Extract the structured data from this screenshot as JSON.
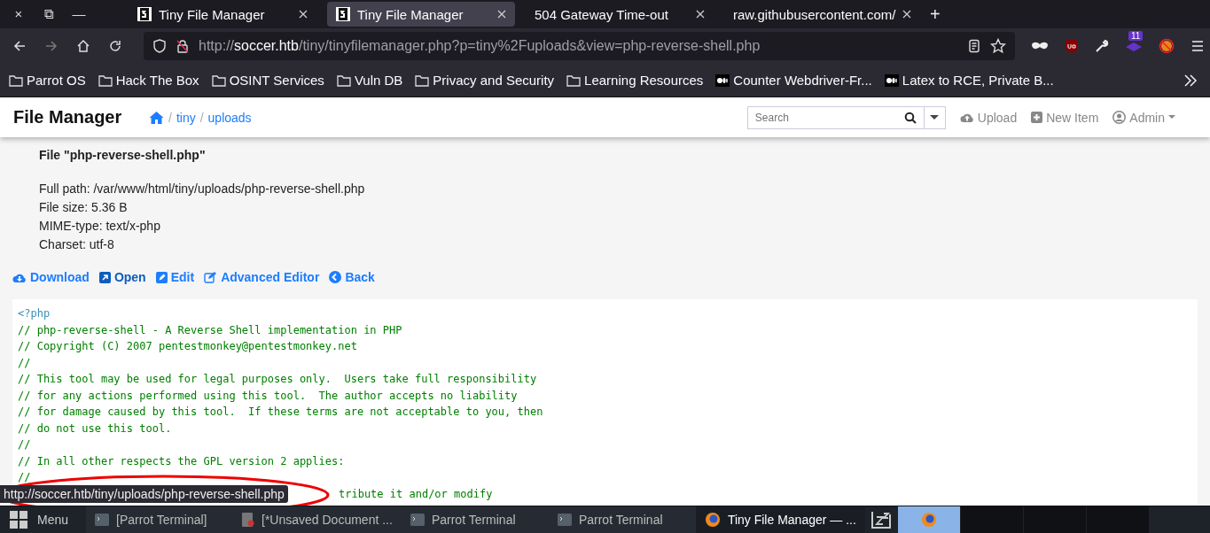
{
  "window_controls": [
    "×",
    "⧉",
    "—"
  ],
  "tabs": [
    {
      "title": "Tiny File Manager",
      "favicon": true,
      "selected": false
    },
    {
      "title": "Tiny File Manager",
      "favicon": true,
      "selected": true
    },
    {
      "title": "504 Gateway Time-out",
      "favicon": false,
      "selected": false
    },
    {
      "title": "raw.githubusercontent.com/",
      "favicon": false,
      "selected": false
    }
  ],
  "new_tab": "+",
  "address_bar": {
    "scheme": "http://",
    "host": "soccer.htb",
    "path": "/tiny/tinyfilemanager.php?p=tiny%2Fuploads&view=php-reverse-shell.php"
  },
  "extension_badge": "11",
  "bookmarks": [
    {
      "kind": "folder",
      "label": "Parrot OS"
    },
    {
      "kind": "folder",
      "label": "Hack The Box"
    },
    {
      "kind": "folder",
      "label": "OSINT Services"
    },
    {
      "kind": "folder",
      "label": "Vuln DB"
    },
    {
      "kind": "folder",
      "label": "Privacy and Security"
    },
    {
      "kind": "folder",
      "label": "Learning Resources"
    },
    {
      "kind": "page",
      "label": "Counter Webdriver-Fr..."
    },
    {
      "kind": "page",
      "label": "Latex to RCE, Private B..."
    }
  ],
  "app": {
    "brand": "File Manager",
    "breadcrumb_separator": "/",
    "breadcrumbs": [
      "tiny",
      "uploads"
    ],
    "search": {
      "placeholder": "Search"
    },
    "actions": [
      {
        "kind": "upload",
        "label": "Upload"
      },
      {
        "kind": "new",
        "label": "New Item"
      },
      {
        "kind": "user",
        "label": "Admin"
      }
    ]
  },
  "file": {
    "title": "File \"php-reverse-shell.php\"",
    "details": [
      "Full path: /var/www/html/tiny/uploads/php-reverse-shell.php",
      "File size: 5.36 B",
      "MIME-type: text/x-php",
      "Charset: utf-8"
    ],
    "links": [
      {
        "kind": "download",
        "label": "Download"
      },
      {
        "kind": "open",
        "label": "Open"
      },
      {
        "kind": "edit",
        "label": "Edit"
      },
      {
        "kind": "advanced",
        "label": "Advanced Editor"
      },
      {
        "kind": "back",
        "label": "Back"
      }
    ]
  },
  "code": [
    {
      "kind": "tag",
      "text": "<?php"
    },
    {
      "kind": "comment",
      "text": "// php-reverse-shell - A Reverse Shell implementation in PHP"
    },
    {
      "kind": "comment",
      "text": "// Copyright (C) 2007 pentestmonkey@pentestmonkey.net"
    },
    {
      "kind": "comment",
      "text": "//"
    },
    {
      "kind": "comment",
      "text": "// This tool may be used for legal purposes only.  Users take full responsibility"
    },
    {
      "kind": "comment",
      "text": "// for any actions performed using this tool.  The author accepts no liability"
    },
    {
      "kind": "comment",
      "text": "// for damage caused by this tool.  If these terms are not acceptable to you, then"
    },
    {
      "kind": "comment",
      "text": "// do not use this tool."
    },
    {
      "kind": "comment",
      "text": "//"
    },
    {
      "kind": "comment",
      "text": "// In all other respects the GPL version 2 applies:"
    },
    {
      "kind": "comment",
      "text": "//"
    }
  ],
  "covered_code_fragment": "tribute it and/or modify",
  "status_url": "http://soccer.htb/tiny/uploads/php-reverse-shell.php",
  "taskbar": {
    "menu": "Menu",
    "items": [
      {
        "kind": "terminal",
        "label": "[Parrot Terminal]",
        "selected": false
      },
      {
        "kind": "editor",
        "label": "[*Unsaved Document ...",
        "selected": false
      },
      {
        "kind": "terminal",
        "label": "Parrot Terminal",
        "selected": false
      },
      {
        "kind": "terminal",
        "label": "Parrot Terminal",
        "selected": false
      },
      {
        "kind": "browser",
        "label": "Tiny File Manager — ...",
        "selected": true
      }
    ],
    "workspaces": [
      {
        "selected": true
      },
      {
        "selected": false
      },
      {
        "selected": false
      },
      {
        "selected": false
      }
    ]
  }
}
